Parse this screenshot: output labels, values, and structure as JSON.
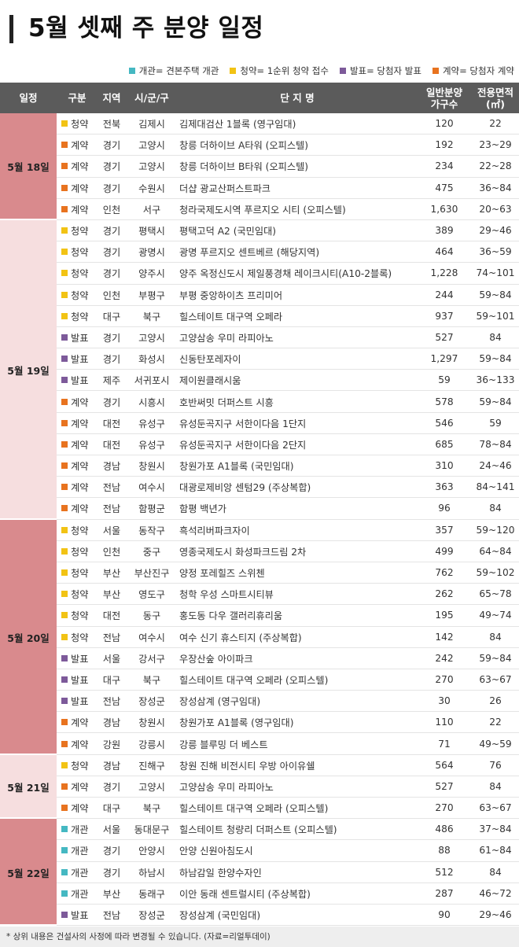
{
  "title": "5월 셋째 주 분양 일정",
  "legend": [
    {
      "label": "개관",
      "desc": "= 견본주택 개관",
      "color": "#45b8c2"
    },
    {
      "label": "청약",
      "desc": "= 1순위 청약 접수",
      "color": "#f2c314"
    },
    {
      "label": "발표",
      "desc": "= 당첨자 발표",
      "color": "#7d5a9a"
    },
    {
      "label": "계약",
      "desc": "= 당첨자 계약",
      "color": "#e8731f"
    }
  ],
  "columns": {
    "date": "일정",
    "type": "구분",
    "region": "지역",
    "city": "시/군/구",
    "name": "단 지 명",
    "units": [
      "일반분양",
      "가구수"
    ],
    "area": [
      "전용면적",
      "(㎡)"
    ]
  },
  "colors": {
    "header_bg": "#5b5b5b",
    "date_dark": "#d98a8d",
    "date_light": "#f6dedf"
  },
  "groups": [
    {
      "date": "5월 18일",
      "bg": "#d98a8d",
      "rows": [
        {
          "type": "청약",
          "region": "전북",
          "city": "김제시",
          "name": "김제대검산 1블록 (영구임대)",
          "units": "120",
          "area": "22"
        },
        {
          "type": "계약",
          "region": "경기",
          "city": "고양시",
          "name": "창릉 더하이브 A타워 (오피스텔)",
          "units": "192",
          "area": "23~29"
        },
        {
          "type": "계약",
          "region": "경기",
          "city": "고양시",
          "name": "창릉 더하이브 B타워 (오피스텔)",
          "units": "234",
          "area": "22~28"
        },
        {
          "type": "계약",
          "region": "경기",
          "city": "수원시",
          "name": "더샵 광교산퍼스트파크",
          "units": "475",
          "area": "36~84"
        },
        {
          "type": "계약",
          "region": "인천",
          "city": "서구",
          "name": "청라국제도시역 푸르지오 시티 (오피스텔)",
          "units": "1,630",
          "area": "20~63"
        }
      ]
    },
    {
      "date": "5월 19일",
      "bg": "#f6dedf",
      "rows": [
        {
          "type": "청약",
          "region": "경기",
          "city": "평택시",
          "name": "평택고덕 A2 (국민임대)",
          "units": "389",
          "area": "29~46"
        },
        {
          "type": "청약",
          "region": "경기",
          "city": "광명시",
          "name": "광명 푸르지오 센트베르 (해당지역)",
          "units": "464",
          "area": "36~59"
        },
        {
          "type": "청약",
          "region": "경기",
          "city": "양주시",
          "name": "양주 옥정신도시 제일풍경채 레이크시티(A10-2블록)",
          "units": "1,228",
          "area": "74~101"
        },
        {
          "type": "청약",
          "region": "인천",
          "city": "부평구",
          "name": "부평 중앙하이츠 프리미어",
          "units": "244",
          "area": "59~84"
        },
        {
          "type": "청약",
          "region": "대구",
          "city": "북구",
          "name": "힐스테이트 대구역 오페라",
          "units": "937",
          "area": "59~101"
        },
        {
          "type": "발표",
          "region": "경기",
          "city": "고양시",
          "name": "고양삼송 우미 라피아노",
          "units": "527",
          "area": "84"
        },
        {
          "type": "발표",
          "region": "경기",
          "city": "화성시",
          "name": "신동탄포레자이",
          "units": "1,297",
          "area": "59~84"
        },
        {
          "type": "발표",
          "region": "제주",
          "city": "서귀포시",
          "name": "제이원클래시움",
          "units": "59",
          "area": "36~133"
        },
        {
          "type": "계약",
          "region": "경기",
          "city": "시흥시",
          "name": "호반써밋 더퍼스트 시흥",
          "units": "578",
          "area": "59~84"
        },
        {
          "type": "계약",
          "region": "대전",
          "city": "유성구",
          "name": "유성둔곡지구 서한이다음 1단지",
          "units": "546",
          "area": "59"
        },
        {
          "type": "계약",
          "region": "대전",
          "city": "유성구",
          "name": "유성둔곡지구 서한이다음 2단지",
          "units": "685",
          "area": "78~84"
        },
        {
          "type": "계약",
          "region": "경남",
          "city": "창원시",
          "name": "창원가포 A1블록 (국민임대)",
          "units": "310",
          "area": "24~46"
        },
        {
          "type": "계약",
          "region": "전남",
          "city": "여수시",
          "name": "대광로제비앙 센텀29 (주상복합)",
          "units": "363",
          "area": "84~141"
        },
        {
          "type": "계약",
          "region": "전남",
          "city": "함평군",
          "name": "함평 백년가",
          "units": "96",
          "area": "84"
        }
      ]
    },
    {
      "date": "5월 20일",
      "bg": "#d98a8d",
      "rows": [
        {
          "type": "청약",
          "region": "서울",
          "city": "동작구",
          "name": "흑석리버파크자이",
          "units": "357",
          "area": "59~120"
        },
        {
          "type": "청약",
          "region": "인천",
          "city": "중구",
          "name": "영종국제도시 화성파크드림 2차",
          "units": "499",
          "area": "64~84"
        },
        {
          "type": "청약",
          "region": "부산",
          "city": "부산진구",
          "name": "양정 포레힐즈 스위첸",
          "units": "762",
          "area": "59~102"
        },
        {
          "type": "청약",
          "region": "부산",
          "city": "영도구",
          "name": "청학 우성 스마트시티뷰",
          "units": "262",
          "area": "65~78"
        },
        {
          "type": "청약",
          "region": "대전",
          "city": "동구",
          "name": "홍도동 다우 갤러리휴리움",
          "units": "195",
          "area": "49~74"
        },
        {
          "type": "청약",
          "region": "전남",
          "city": "여수시",
          "name": "여수 신기 휴스티지 (주상복합)",
          "units": "142",
          "area": "84"
        },
        {
          "type": "발표",
          "region": "서울",
          "city": "강서구",
          "name": "우장산숲 아이파크",
          "units": "242",
          "area": "59~84"
        },
        {
          "type": "발표",
          "region": "대구",
          "city": "북구",
          "name": "힐스테이트 대구역 오페라 (오피스텔)",
          "units": "270",
          "area": "63~67"
        },
        {
          "type": "발표",
          "region": "전남",
          "city": "장성군",
          "name": "장성삼계 (영구임대)",
          "units": "30",
          "area": "26"
        },
        {
          "type": "계약",
          "region": "경남",
          "city": "창원시",
          "name": "창원가포 A1블록 (영구임대)",
          "units": "110",
          "area": "22"
        },
        {
          "type": "계약",
          "region": "강원",
          "city": "강릉시",
          "name": "강릉 블루밍 더 베스트",
          "units": "71",
          "area": "49~59"
        }
      ]
    },
    {
      "date": "5월 21일",
      "bg": "#f6dedf",
      "rows": [
        {
          "type": "청약",
          "region": "경남",
          "city": "진해구",
          "name": "창원 진해 비전시티 우방 아이유쉘",
          "units": "564",
          "area": "76"
        },
        {
          "type": "계약",
          "region": "경기",
          "city": "고양시",
          "name": "고양삼송 우미 라피아노",
          "units": "527",
          "area": "84"
        },
        {
          "type": "계약",
          "region": "대구",
          "city": "북구",
          "name": "힐스테이트 대구역 오페라 (오피스텔)",
          "units": "270",
          "area": "63~67"
        }
      ]
    },
    {
      "date": "5월 22일",
      "bg": "#d98a8d",
      "rows": [
        {
          "type": "개관",
          "region": "서울",
          "city": "동대문구",
          "name": "힐스테이트 청량리 더퍼스트 (오피스텔)",
          "units": "486",
          "area": "37~84"
        },
        {
          "type": "개관",
          "region": "경기",
          "city": "안양시",
          "name": "안양 신원아침도시",
          "units": "88",
          "area": "61~84"
        },
        {
          "type": "개관",
          "region": "경기",
          "city": "하남시",
          "name": "하남감일 한양수자인",
          "units": "512",
          "area": "84"
        },
        {
          "type": "개관",
          "region": "부산",
          "city": "동래구",
          "name": "이안 동래 센트럴시티 (주상복합)",
          "units": "287",
          "area": "46~72"
        },
        {
          "type": "발표",
          "region": "전남",
          "city": "장성군",
          "name": "장성삼계 (국민임대)",
          "units": "90",
          "area": "29~46"
        }
      ]
    }
  ],
  "footer": "* 상위 내용은 건설사의 사정에 따라 변경될 수 있습니다. (자료=리얼투데이)"
}
